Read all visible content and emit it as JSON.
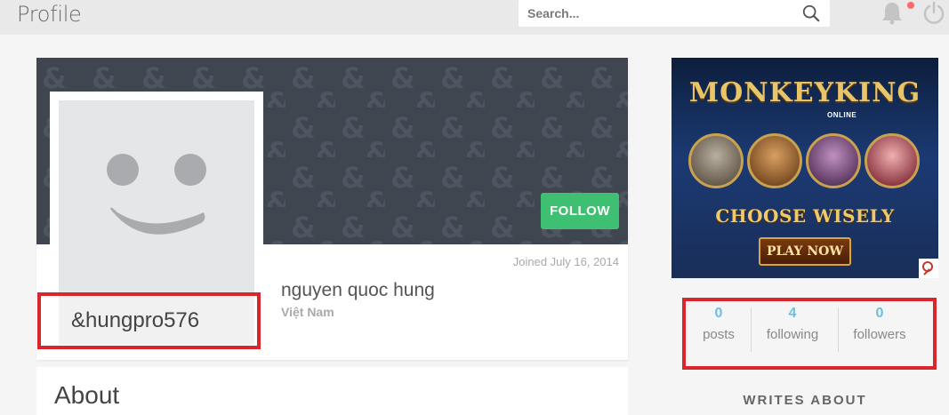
{
  "header": {
    "title": "Profile",
    "search_placeholder": "Search..."
  },
  "icons": {
    "search": "search-icon",
    "notifications": "bell-icon",
    "power": "power-icon",
    "avatar_placeholder": "smiley-face-icon"
  },
  "profile": {
    "follow_label": "FOLLOW",
    "joined": "Joined July 16, 2014",
    "full_name": "nguyen quoc hung",
    "location": "Việt Nam",
    "handle": "&hungpro576"
  },
  "about": {
    "title": "About"
  },
  "ad": {
    "logo": "MONKEYKING",
    "logo_sub": "ONLINE",
    "headline": "CHOOSE WISELY",
    "cta": "PLAY NOW"
  },
  "stats": {
    "posts_value": "0",
    "posts_label": "posts",
    "following_value": "4",
    "following_label": "following",
    "followers_value": "0",
    "followers_label": "followers"
  },
  "sidebar": {
    "writes_about": "WRITES ABOUT"
  },
  "colors": {
    "cover": "#3f4650",
    "follow": "#3ebf72",
    "stat_value": "#6cbde8",
    "highlight": "#d9262c"
  }
}
